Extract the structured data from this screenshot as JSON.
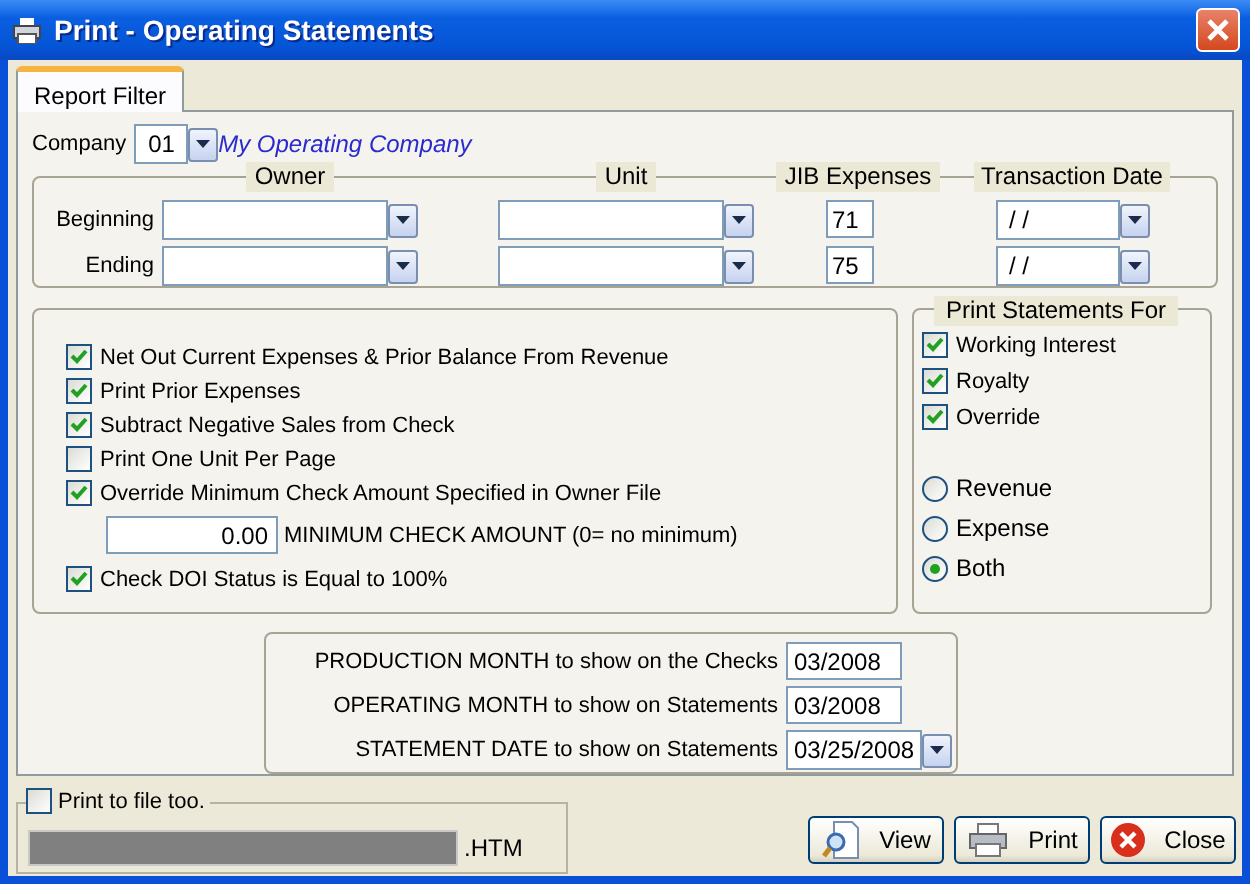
{
  "window": {
    "title": "Print - Operating Statements"
  },
  "tabs": [
    {
      "label": "Report Filter",
      "selected": true
    }
  ],
  "company": {
    "label": "Company",
    "value": "01",
    "name": "My Operating Company"
  },
  "range": {
    "columns": [
      "Owner",
      "Unit",
      "JIB Expenses",
      "Transaction Date"
    ],
    "rows": [
      {
        "label": "Beginning",
        "jib": "71",
        "date": "/ /"
      },
      {
        "label": "Ending",
        "jib": "75",
        "date": "/ /"
      }
    ]
  },
  "options": [
    {
      "kind": "checkbox",
      "label": "Net Out Current Expenses & Prior Balance From Revenue",
      "checked": true
    },
    {
      "kind": "checkbox",
      "label": "Print Prior Expenses",
      "checked": true
    },
    {
      "kind": "checkbox",
      "label": "Subtract Negative Sales from Check",
      "checked": true
    },
    {
      "kind": "checkbox",
      "label": "Print One Unit Per Page",
      "checked": false
    },
    {
      "kind": "checkbox",
      "label": "Override Minimum Check Amount Specified in Owner File",
      "checked": true
    },
    {
      "kind": "amount",
      "value": "0.00",
      "label": "MINIMUM CHECK AMOUNT (0= no minimum)"
    },
    {
      "kind": "checkbox",
      "label": "Check DOI Status is Equal to 100%",
      "checked": true
    }
  ],
  "print_for": {
    "title": "Print Statements For",
    "types": [
      {
        "label": "Working Interest",
        "checked": true
      },
      {
        "label": "Royalty",
        "checked": true
      },
      {
        "label": "Override",
        "checked": true
      }
    ],
    "modes": [
      {
        "label": "Revenue",
        "selected": false
      },
      {
        "label": "Expense",
        "selected": false
      },
      {
        "label": "Both",
        "selected": true
      }
    ]
  },
  "months": [
    {
      "label": "PRODUCTION MONTH to show on the Checks",
      "value": "03/2008",
      "dropdown": false
    },
    {
      "label": "OPERATING MONTH to show on Statements",
      "value": "03/2008",
      "dropdown": false
    },
    {
      "label": "STATEMENT DATE to show on Statements",
      "value": "03/25/2008",
      "dropdown": true
    }
  ],
  "print_to_file": {
    "label": "Print to file too.",
    "checked": false,
    "extension": ".HTM"
  },
  "buttons": [
    {
      "kind": "view",
      "label": "View"
    },
    {
      "kind": "print",
      "label": "Print"
    },
    {
      "kind": "close",
      "label": "Close"
    }
  ]
}
